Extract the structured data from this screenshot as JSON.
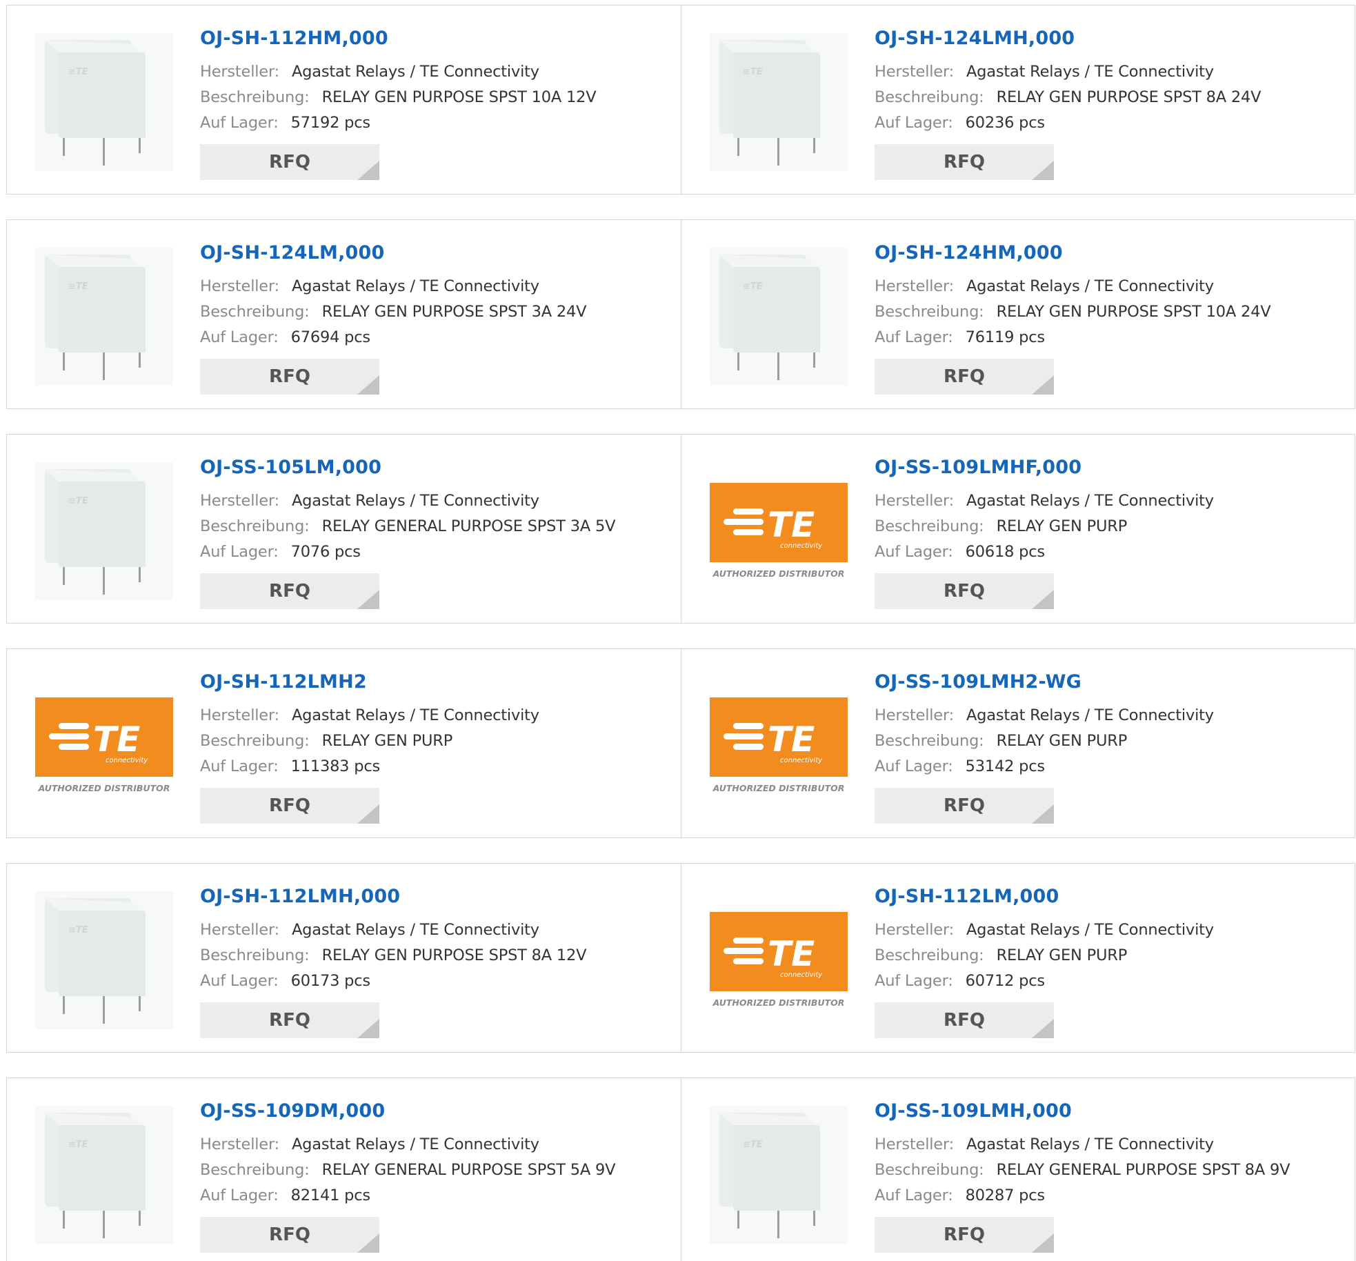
{
  "labels": {
    "manufacturer": "Hersteller:",
    "description": "Beschreibung:",
    "stock": "Auf Lager:",
    "rfq": "RFQ"
  },
  "colors": {
    "link": "#1565b8",
    "label": "#8a8a8a",
    "value": "#333333",
    "rfq_bg": "#ececec",
    "te_orange": "#f28c1e"
  },
  "logo": {
    "brand": "TE",
    "tagline": "connectivity",
    "caption": "AUTHORIZED DISTRIBUTOR"
  },
  "products": [
    {
      "part": "OJ-SH-112HM,000",
      "manufacturer": "Agastat Relays / TE Connectivity",
      "description": "RELAY GEN PURPOSE SPST 10A 12V",
      "stock": "57192 pcs",
      "image": "relay-photo"
    },
    {
      "part": "OJ-SH-124LMH,000",
      "manufacturer": "Agastat Relays / TE Connectivity",
      "description": "RELAY GEN PURPOSE SPST 8A 24V",
      "stock": "60236 pcs",
      "image": "relay-photo"
    },
    {
      "part": "OJ-SH-124LM,000",
      "manufacturer": "Agastat Relays / TE Connectivity",
      "description": "RELAY GEN PURPOSE SPST 3A 24V",
      "stock": "67694 pcs",
      "image": "relay-photo"
    },
    {
      "part": "OJ-SH-124HM,000",
      "manufacturer": "Agastat Relays / TE Connectivity",
      "description": "RELAY GEN PURPOSE SPST 10A 24V",
      "stock": "76119 pcs",
      "image": "relay-photo"
    },
    {
      "part": "OJ-SS-105LM,000",
      "manufacturer": "Agastat Relays / TE Connectivity",
      "description": "RELAY GENERAL PURPOSE SPST 3A 5V",
      "stock": "7076 pcs",
      "image": "relay-photo"
    },
    {
      "part": "OJ-SS-109LMHF,000",
      "manufacturer": "Agastat Relays / TE Connectivity",
      "description": "RELAY GEN PURP",
      "stock": "60618 pcs",
      "image": "te-logo"
    },
    {
      "part": "OJ-SH-112LMH2",
      "manufacturer": "Agastat Relays / TE Connectivity",
      "description": "RELAY GEN PURP",
      "stock": "111383 pcs",
      "image": "te-logo"
    },
    {
      "part": "OJ-SS-109LMH2-WG",
      "manufacturer": "Agastat Relays / TE Connectivity",
      "description": "RELAY GEN PURP",
      "stock": "53142 pcs",
      "image": "te-logo"
    },
    {
      "part": "OJ-SH-112LMH,000",
      "manufacturer": "Agastat Relays / TE Connectivity",
      "description": "RELAY GEN PURPOSE SPST 8A 12V",
      "stock": "60173 pcs",
      "image": "relay-photo"
    },
    {
      "part": "OJ-SH-112LM,000",
      "manufacturer": "Agastat Relays / TE Connectivity",
      "description": "RELAY GEN PURP",
      "stock": "60712 pcs",
      "image": "te-logo"
    },
    {
      "part": "OJ-SS-109DM,000",
      "manufacturer": "Agastat Relays / TE Connectivity",
      "description": "RELAY GENERAL PURPOSE SPST 5A 9V",
      "stock": "82141 pcs",
      "image": "relay-photo"
    },
    {
      "part": "OJ-SS-109LMH,000",
      "manufacturer": "Agastat Relays / TE Connectivity",
      "description": "RELAY GENERAL PURPOSE SPST 8A 9V",
      "stock": "80287 pcs",
      "image": "relay-photo"
    }
  ]
}
